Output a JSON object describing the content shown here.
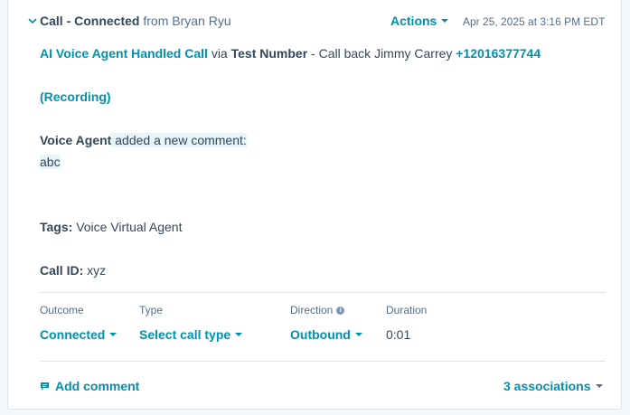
{
  "header": {
    "title": "Call - Connected",
    "from_text": "from Bryan Ryu",
    "actions_label": "Actions",
    "timestamp": "Apr 25, 2025 at 3:16 PM EDT"
  },
  "summary": {
    "agent_link": "AI Voice Agent Handled Call",
    "via": "via",
    "number_name": "Test Number",
    "callback_text": "- Call back Jimmy Carrey",
    "phone": "+12016377744",
    "recording_link": "(Recording)"
  },
  "comment": {
    "author": "Voice Agent",
    "action": "added a new comment:",
    "body": "abc"
  },
  "tags": {
    "label": "Tags:",
    "value": "Voice Virtual Agent"
  },
  "call_id": {
    "label": "Call ID:",
    "value": "xyz"
  },
  "properties": {
    "outcome_label": "Outcome",
    "outcome_value": "Connected",
    "type_label": "Type",
    "type_value": "Select call type",
    "direction_label": "Direction",
    "direction_value": "Outbound",
    "duration_label": "Duration",
    "duration_value": "0:01"
  },
  "footer": {
    "add_comment": "Add comment",
    "associations": "3 associations"
  },
  "colors": {
    "accent": "#0091ae",
    "text": "#33475b",
    "highlight": "#e5f5f8"
  }
}
